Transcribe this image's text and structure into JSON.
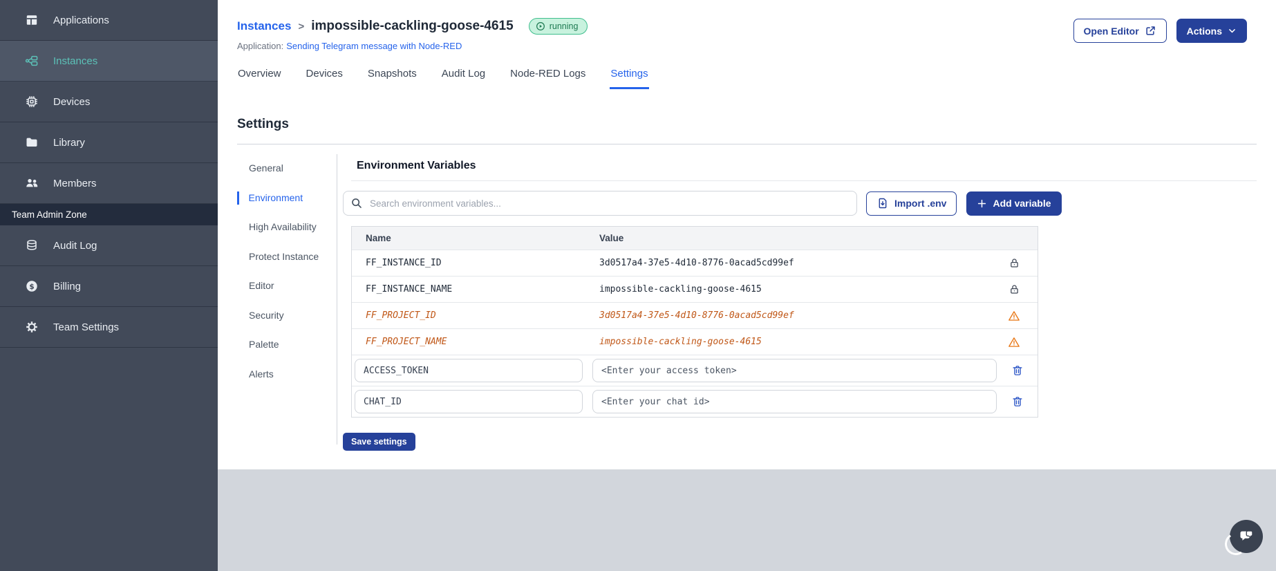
{
  "colors": {
    "accent-navy": "#26419a",
    "accent-blue": "#2563eb",
    "accent-teal": "#5cc2b8",
    "sidebar-bg": "#424a59",
    "sidebar-active-bg": "#4e5767",
    "sidebar-zone-bg": "#232c3d",
    "badge-bg": "#c8f2de",
    "badge-border": "#3fbe8d",
    "badge-text": "#1e7a52",
    "deprecated-text": "#c05717",
    "warning-icon-color": "#e87613",
    "gray-band": "#d2d6dc"
  },
  "sidebar": {
    "items": [
      {
        "id": "applications",
        "label": "Applications",
        "icon": "applications-grid",
        "active": false
      },
      {
        "id": "instances",
        "label": "Instances",
        "icon": "node-red-flow",
        "active": true
      },
      {
        "id": "devices",
        "label": "Devices",
        "icon": "chip",
        "active": false
      },
      {
        "id": "library",
        "label": "Library",
        "icon": "folder",
        "active": false
      },
      {
        "id": "members",
        "label": "Members",
        "icon": "users",
        "active": false
      }
    ],
    "section_label": "Team Admin Zone",
    "admin_items": [
      {
        "id": "audit-log",
        "label": "Audit Log",
        "icon": "database",
        "active": false
      },
      {
        "id": "billing",
        "label": "Billing",
        "icon": "dollar-circle",
        "active": false
      },
      {
        "id": "team-settings",
        "label": "Team Settings",
        "icon": "gear",
        "active": false
      }
    ]
  },
  "header": {
    "breadcrumb_parent": "Instances",
    "separator": ">",
    "instance_name": "impossible-cackling-goose-4615",
    "status_badge": "running",
    "application_label": "Application:",
    "application_link": "Sending Telegram message with Node-RED",
    "open_editor_label": "Open Editor",
    "actions_label": "Actions"
  },
  "tabs": [
    {
      "id": "overview",
      "label": "Overview",
      "active": false
    },
    {
      "id": "devices",
      "label": "Devices",
      "active": false
    },
    {
      "id": "snapshots",
      "label": "Snapshots",
      "active": false
    },
    {
      "id": "audit-log",
      "label": "Audit Log",
      "active": false
    },
    {
      "id": "node-red-logs",
      "label": "Node-RED Logs",
      "active": false
    },
    {
      "id": "settings",
      "label": "Settings",
      "active": true
    }
  ],
  "settings": {
    "title": "Settings",
    "nav": [
      {
        "id": "general",
        "label": "General",
        "active": false
      },
      {
        "id": "environment",
        "label": "Environment",
        "active": true
      },
      {
        "id": "high-availability",
        "label": "High Availability",
        "active": false
      },
      {
        "id": "protect-instance",
        "label": "Protect Instance",
        "active": false
      },
      {
        "id": "editor",
        "label": "Editor",
        "active": false
      },
      {
        "id": "security",
        "label": "Security",
        "active": false
      },
      {
        "id": "palette",
        "label": "Palette",
        "active": false
      },
      {
        "id": "alerts",
        "label": "Alerts",
        "active": false
      }
    ],
    "panel_title": "Environment Variables",
    "search_placeholder": "Search environment variables...",
    "import_button": "Import .env",
    "add_button": "Add variable",
    "save_button": "Save settings",
    "table": {
      "columns": [
        "Name",
        "Value"
      ],
      "rows": [
        {
          "name": "FF_INSTANCE_ID",
          "value": "3d0517a4-37e5-4d10-8776-0acad5cd99ef",
          "state": "locked"
        },
        {
          "name": "FF_INSTANCE_NAME",
          "value": "impossible-cackling-goose-4615",
          "state": "locked"
        },
        {
          "name": "FF_PROJECT_ID",
          "value": "3d0517a4-37e5-4d10-8776-0acad5cd99ef",
          "state": "deprecated"
        },
        {
          "name": "FF_PROJECT_NAME",
          "value": "impossible-cackling-goose-4615",
          "state": "deprecated"
        },
        {
          "name": "ACCESS_TOKEN",
          "value": "<Enter your access token>",
          "state": "editable"
        },
        {
          "name": "CHAT_ID",
          "value": "<Enter your chat id>",
          "state": "editable"
        }
      ]
    }
  }
}
